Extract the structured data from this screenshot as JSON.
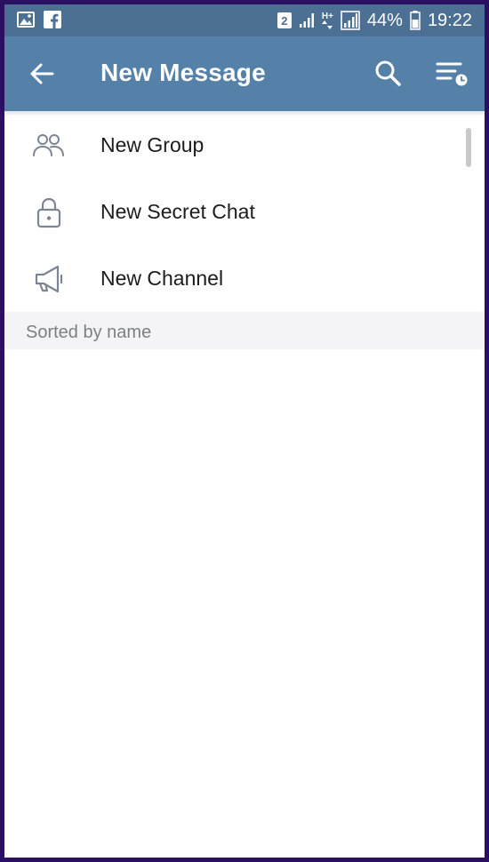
{
  "status_bar": {
    "sim_slot": "2",
    "network_type": "H+",
    "battery_percent": "44%",
    "time": "19:22",
    "icons": [
      "gallery-icon",
      "facebook-icon",
      "sim-badge",
      "signal-icon",
      "data-arrows-icon",
      "signal-icon",
      "battery-icon"
    ]
  },
  "header": {
    "title": "New Message",
    "icons": [
      "back-arrow-icon",
      "search-icon",
      "sort-icon"
    ]
  },
  "menu": {
    "items": [
      {
        "label": "New Group",
        "icon": "group-icon"
      },
      {
        "label": "New Secret Chat",
        "icon": "lock-icon"
      },
      {
        "label": "New Channel",
        "icon": "megaphone-icon"
      }
    ]
  },
  "contacts": {
    "section_header": "Sorted by name"
  },
  "colors": {
    "status_bar": "#4c6f94",
    "toolbar": "#5580a8",
    "section_header_bg": "#f4f4f6",
    "frame": "#2b0f63"
  }
}
